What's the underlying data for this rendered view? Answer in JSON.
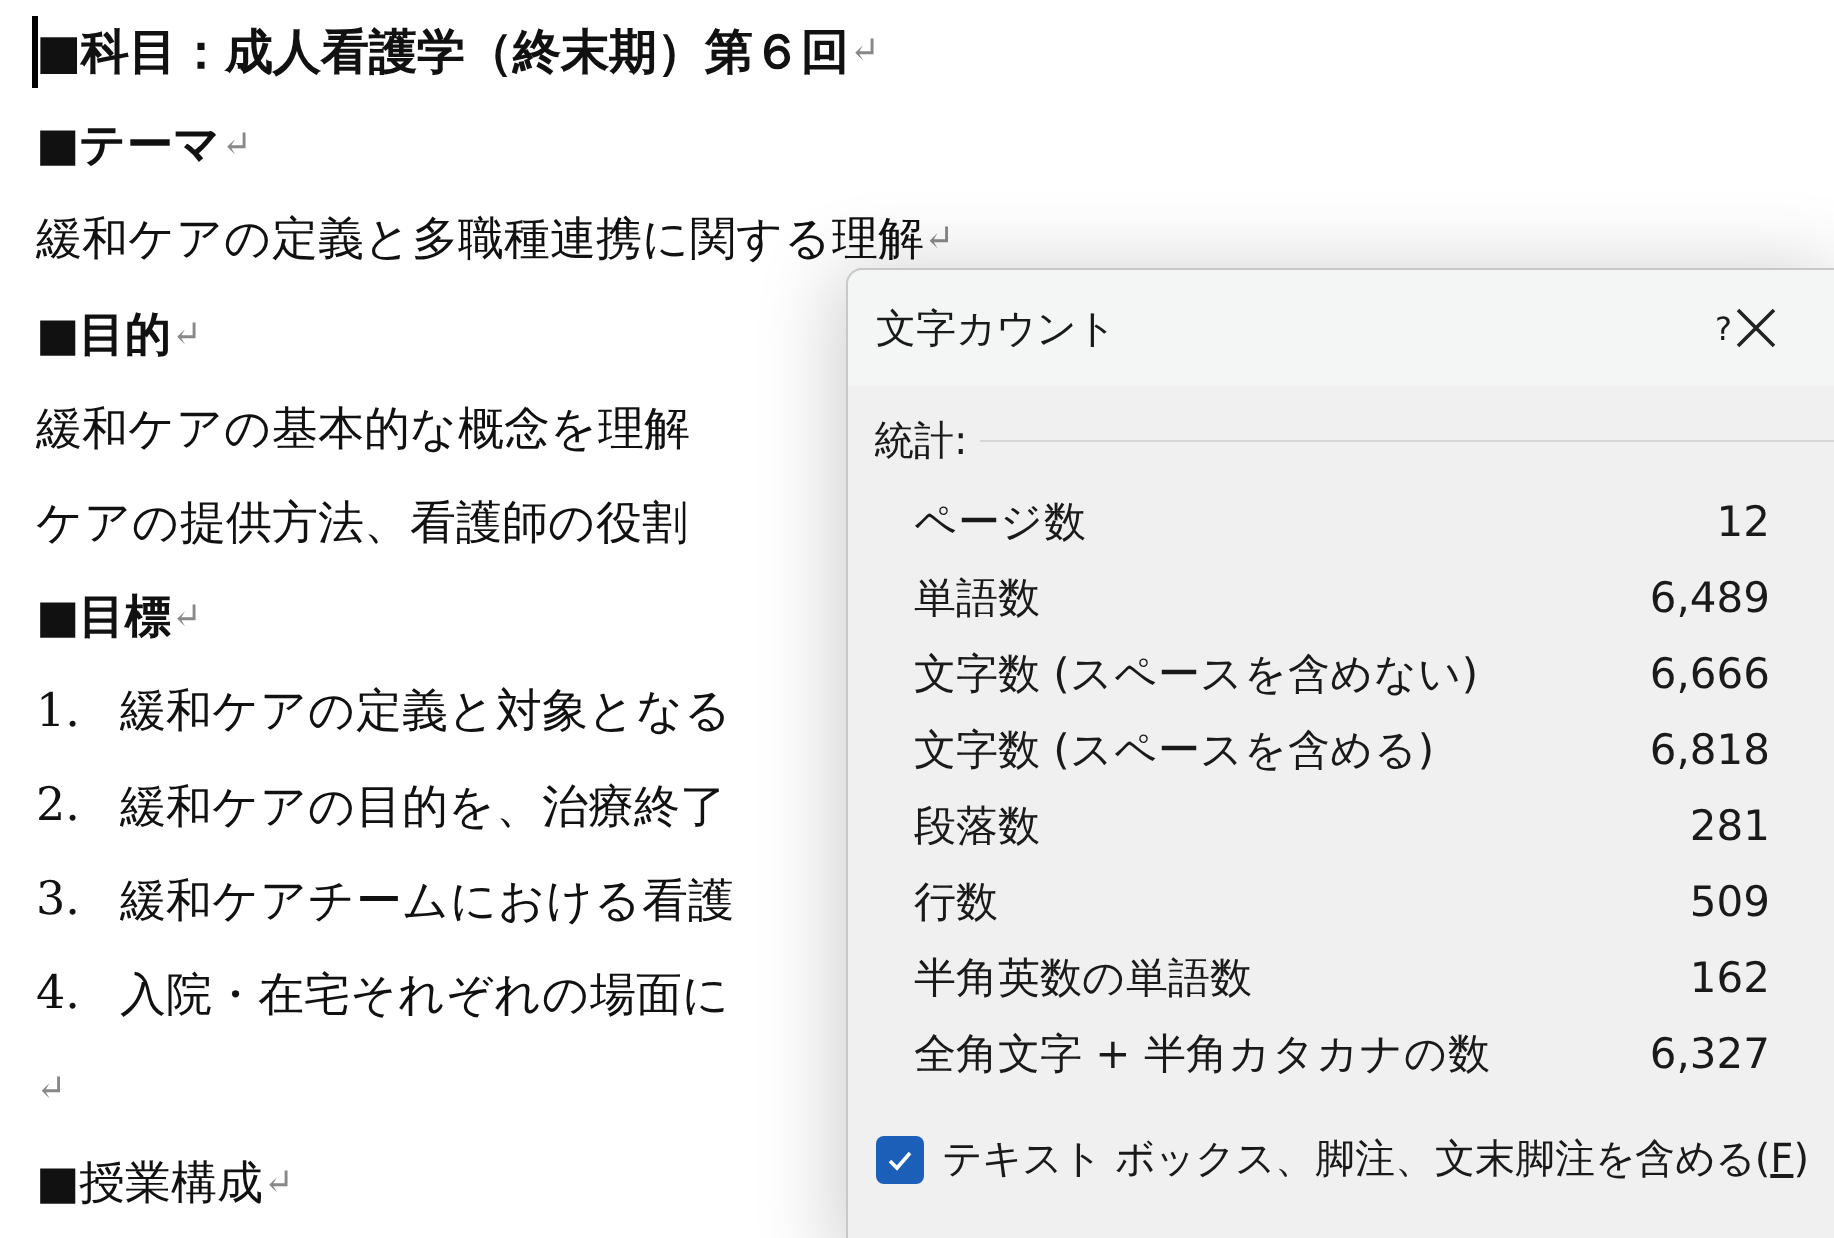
{
  "document": {
    "paragraphs": [
      {
        "kind": "heading",
        "text": "■科目：成人看護学（終末期）第６回",
        "mark": "↵"
      },
      {
        "kind": "subheading",
        "text": "■テーマ",
        "mark": "↵"
      },
      {
        "kind": "body",
        "text": "緩和ケアの定義と多職種連携に関する理解",
        "mark": "↵"
      },
      {
        "kind": "subheading",
        "text": "■目的",
        "mark": "↵"
      },
      {
        "kind": "body",
        "text": "緩和ケアの基本的な概念を理解"
      },
      {
        "kind": "body",
        "text": "ケアの提供方法、看護師の役割"
      },
      {
        "kind": "subheading",
        "text": "■目標",
        "mark": "↵"
      },
      {
        "kind": "list",
        "number": "1.",
        "text": "緩和ケアの定義と対象となる"
      },
      {
        "kind": "list",
        "number": "2.",
        "text": "緩和ケアの目的を、治療終了"
      },
      {
        "kind": "list",
        "number": "3.",
        "text": "緩和ケアチームにおける看護"
      },
      {
        "kind": "list",
        "number": "4.",
        "text": "入院・在宅それぞれの場面に"
      },
      {
        "kind": "empty",
        "mark": "↵"
      },
      {
        "kind": "plain-heading",
        "text": "■授業構成",
        "mark": "↵"
      }
    ]
  },
  "dialog": {
    "title": "文字カウント",
    "help": "?",
    "section": "統計:",
    "stats": [
      {
        "label": "ページ数",
        "value": "12"
      },
      {
        "label": "単語数",
        "value": "6,489"
      },
      {
        "label": "文字数 (スペースを含めない)",
        "value": "6,666"
      },
      {
        "label": "文字数 (スペースを含める)",
        "value": "6,818"
      },
      {
        "label": "段落数",
        "value": "281"
      },
      {
        "label": "行数",
        "value": "509"
      },
      {
        "label": "半角英数の単語数",
        "value": "162"
      },
      {
        "label": "全角文字 + 半角カタカナの数",
        "value": "6,327"
      }
    ],
    "checkbox": {
      "label": "テキスト ボックス、脚注、文末脚注を含める(",
      "access_key": "F",
      "label_end": ")",
      "checked": true
    }
  }
}
